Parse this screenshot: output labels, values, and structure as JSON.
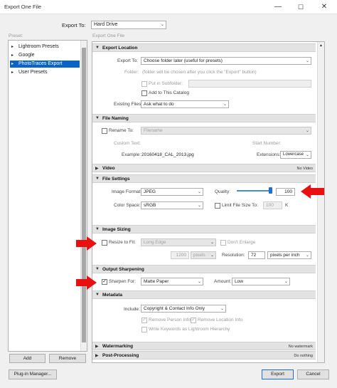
{
  "window": {
    "title": "Export One File"
  },
  "top": {
    "export_to_label": "Export To:",
    "export_to_value": "Hard Drive"
  },
  "preset": {
    "label": "Preset:",
    "items": [
      "Lightroom Presets",
      "Google",
      "PhotoTraces Export",
      "User Presets"
    ],
    "selected_index": 2,
    "add_label": "Add",
    "remove_label": "Remove"
  },
  "panel": {
    "title": "Export One File"
  },
  "export_location": {
    "header": "Export Location",
    "export_to_label": "Export To:",
    "export_to_value": "Choose folder later (useful for presets)",
    "folder_label": "Folder:",
    "folder_value": "(folder will be chosen after you click the \"Export\" button)",
    "subfolder_label": "Put in Subfolder:",
    "add_catalog_label": "Add to This Catalog",
    "existing_label": "Existing Files:",
    "existing_value": "Ask what to do"
  },
  "file_naming": {
    "header": "File Naming",
    "rename_label": "Rename To:",
    "rename_value": "Filename",
    "custom_text_label": "Custom Text:",
    "start_number_label": "Start Number:",
    "example_label": "Example:",
    "example_value": "20160418_CAL_2013.jpg",
    "extensions_label": "Extensions:",
    "extensions_value": "Lowercase"
  },
  "video": {
    "header": "Video",
    "summary": "No Video"
  },
  "file_settings": {
    "header": "File Settings",
    "format_label": "Image Format:",
    "format_value": "JPEG",
    "quality_label": "Quality:",
    "quality_value": "100",
    "quality_level": 1.0,
    "color_space_label": "Color Space:",
    "color_space_value": "sRGB",
    "limit_label": "Limit File Size To:",
    "limit_value": "100",
    "limit_unit": "K"
  },
  "image_sizing": {
    "header": "Image Sizing",
    "resize_label": "Resize to Fit:",
    "resize_value": "Long Edge",
    "dont_enlarge_label": "Don't Enlarge",
    "size_value": "1200",
    "size_unit": "pixels",
    "resolution_label": "Resolution:",
    "resolution_value": "72",
    "resolution_unit": "pixels per inch"
  },
  "output_sharpening": {
    "header": "Output Sharpening",
    "sharpen_label": "Sharpen For:",
    "sharpen_value": "Matte Paper",
    "amount_label": "Amount:",
    "amount_value": "Low"
  },
  "metadata": {
    "header": "Metadata",
    "include_label": "Include:",
    "include_value": "Copyright & Contact Info Only",
    "remove_person_label": "Remove Person Info",
    "remove_location_label": "Remove Location Info",
    "write_keywords_label": "Write Keywords as Lightroom Hierarchy"
  },
  "watermarking": {
    "header": "Watermarking",
    "summary": "No watermark"
  },
  "post_processing": {
    "header": "Post-Processing",
    "summary": "Do nothing"
  },
  "footer": {
    "plugin_label": "Plug-in Manager...",
    "export_label": "Export",
    "cancel_label": "Cancel"
  },
  "colors": {
    "arrow": "#e81010",
    "selection": "#0a64c8",
    "header_bg": "#e3e3e3"
  }
}
